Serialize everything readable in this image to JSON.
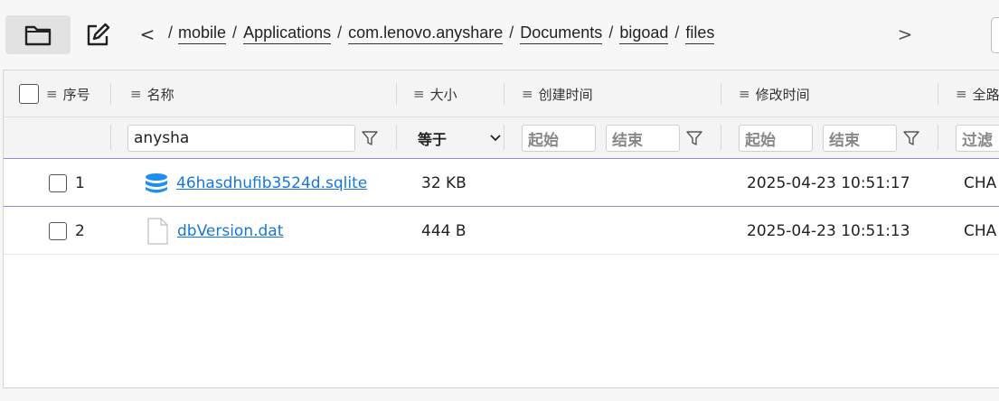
{
  "toolbar": {
    "folder_icon": "folder-icon",
    "edit_icon": "edit-icon",
    "back_glyph": "<",
    "forward_glyph": ">",
    "lead": "/",
    "breadcrumbs": [
      "mobile",
      "Applications",
      "com.lenovo.anyshare",
      "Documents",
      "bigoad",
      "files"
    ],
    "sep": "/"
  },
  "table": {
    "headers": {
      "index": "序号",
      "name": "名称",
      "size": "大小",
      "created": "创建时间",
      "modified": "修改时间",
      "path": "全路"
    },
    "filters": {
      "name_value": "anysha",
      "size_op": "等于",
      "created_start": "起始",
      "created_end": "结束",
      "modified_start": "起始",
      "modified_end": "结束",
      "path_filter": "过滤"
    },
    "rows": [
      {
        "index": "1",
        "name": "46hasdhufib3524d.sqlite",
        "icon": "database-icon",
        "size": "32 KB",
        "created": "",
        "modified": "2025-04-23 10:51:17",
        "path": "CHA"
      },
      {
        "index": "2",
        "name": "dbVersion.dat",
        "icon": "file-icon",
        "size": "444 B",
        "created": "",
        "modified": "2025-04-23 10:51:13",
        "path": "CHA"
      }
    ]
  },
  "colors": {
    "link": "#1677d9",
    "selection_line": "#8c8cdc",
    "db_icon": "#1f8ef1"
  }
}
